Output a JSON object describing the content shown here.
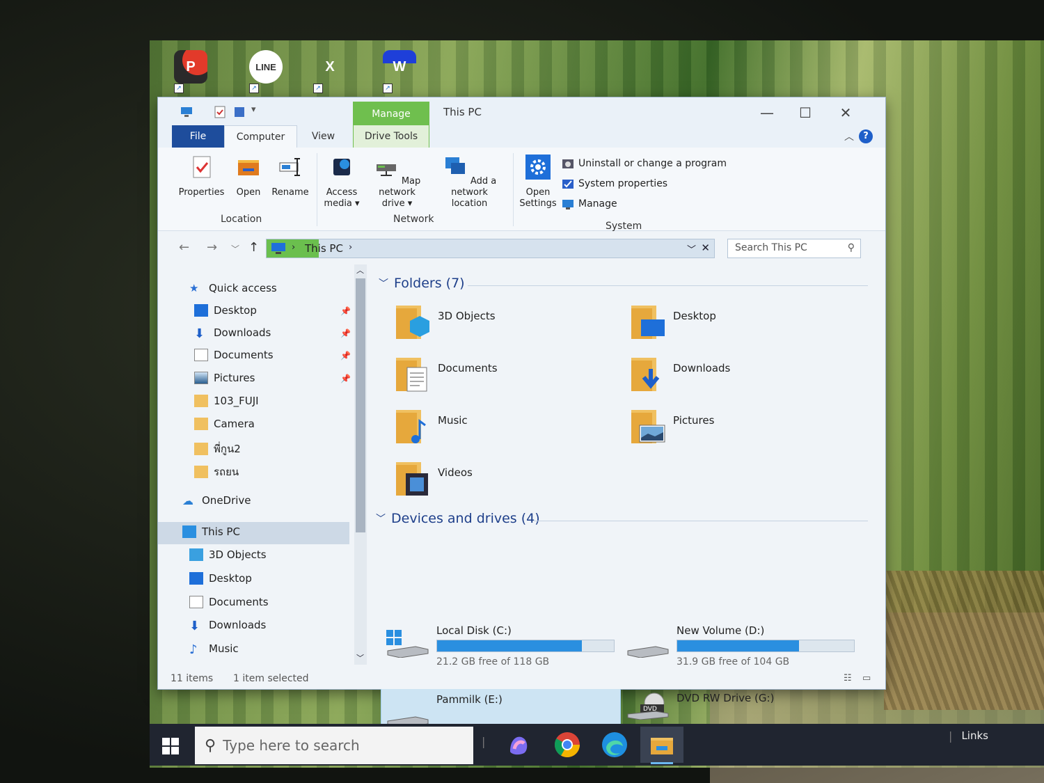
{
  "desktop": {
    "icons": [
      {
        "name": "P",
        "color": "#d23b2b"
      },
      {
        "name": "LINE",
        "color": "#ffffff"
      },
      {
        "name": "X",
        "color": "#333333"
      },
      {
        "name": "W",
        "color": "#1e4fc9"
      }
    ]
  },
  "window": {
    "title": "This PC",
    "manage_tab": "Manage",
    "tabs": {
      "file": "File",
      "computer": "Computer",
      "view": "View",
      "drive_tools": "Drive Tools"
    },
    "controls": {
      "minimize": "—",
      "maximize": "☐",
      "close": "✕"
    },
    "help": "?"
  },
  "ribbon": {
    "location": {
      "label": "Location",
      "buttons": [
        {
          "label": "Properties",
          "icon": "properties-icon"
        },
        {
          "label": "Open",
          "icon": "open-folder-icon"
        },
        {
          "label": "Rename",
          "icon": "rename-icon"
        }
      ]
    },
    "network": {
      "label": "Network",
      "buttons": [
        {
          "label_1": "Access",
          "label_2": "media",
          "icon": "media-icon"
        },
        {
          "label_1": "Map network",
          "label_2": "drive",
          "icon": "network-drive-icon"
        },
        {
          "label_1": "Add a network",
          "label_2": "location",
          "icon": "network-location-icon"
        }
      ]
    },
    "system": {
      "label": "System",
      "open_settings_1": "Open",
      "open_settings_2": "Settings",
      "items": [
        {
          "label": "Uninstall or change a program",
          "icon": "uninstall-icon"
        },
        {
          "label": "System properties",
          "icon": "system-properties-icon"
        },
        {
          "label": "Manage",
          "icon": "manage-icon"
        }
      ]
    }
  },
  "address": {
    "path": "This PC",
    "search_placeholder": "Search This PC"
  },
  "nav": {
    "quick_access": "Quick access",
    "quick_items": [
      {
        "label": "Desktop",
        "pinned": true
      },
      {
        "label": "Downloads",
        "pinned": true
      },
      {
        "label": "Documents",
        "pinned": true
      },
      {
        "label": "Pictures",
        "pinned": true
      },
      {
        "label": "103_FUJI",
        "pinned": false
      },
      {
        "label": "Camera",
        "pinned": false
      },
      {
        "label": "พี่กูน2",
        "pinned": false
      },
      {
        "label": "รถยน",
        "pinned": false
      }
    ],
    "onedrive": "OneDrive",
    "this_pc": "This PC",
    "pc_items": [
      {
        "label": "3D Objects"
      },
      {
        "label": "Desktop"
      },
      {
        "label": "Documents"
      },
      {
        "label": "Downloads"
      },
      {
        "label": "Music"
      }
    ]
  },
  "content": {
    "folders_header": "Folders (7)",
    "folders": [
      {
        "label": "3D Objects",
        "icon": "3d-objects-icon"
      },
      {
        "label": "Desktop",
        "icon": "desktop-folder-icon"
      },
      {
        "label": "Documents",
        "icon": "documents-folder-icon"
      },
      {
        "label": "Downloads",
        "icon": "downloads-folder-icon"
      },
      {
        "label": "Music",
        "icon": "music-folder-icon"
      },
      {
        "label": "Pictures",
        "icon": "pictures-folder-icon"
      },
      {
        "label": "Videos",
        "icon": "videos-folder-icon"
      }
    ],
    "drives_header": "Devices and drives (4)",
    "drives": [
      {
        "label": "Local Disk (C:)",
        "free": "21.2 GB free of 118 GB",
        "used_fraction": 0.82
      },
      {
        "label": "New Volume (D:)",
        "free": "31.9 GB free of 104 GB",
        "used_fraction": 0.69
      },
      {
        "label": "Pammilk (E:)",
        "free": "",
        "used_fraction": null
      },
      {
        "label": "DVD RW Drive (G:)",
        "free": "",
        "used_fraction": null
      }
    ]
  },
  "status": {
    "items": "11 items",
    "selected": "1 item selected"
  },
  "taskbar": {
    "search_placeholder": "Type here to search",
    "links": "Links"
  },
  "colors": {
    "accent": "#1e4d9c",
    "manage_green": "#6fbf4e",
    "drive_bar": "#2a8fe0"
  }
}
